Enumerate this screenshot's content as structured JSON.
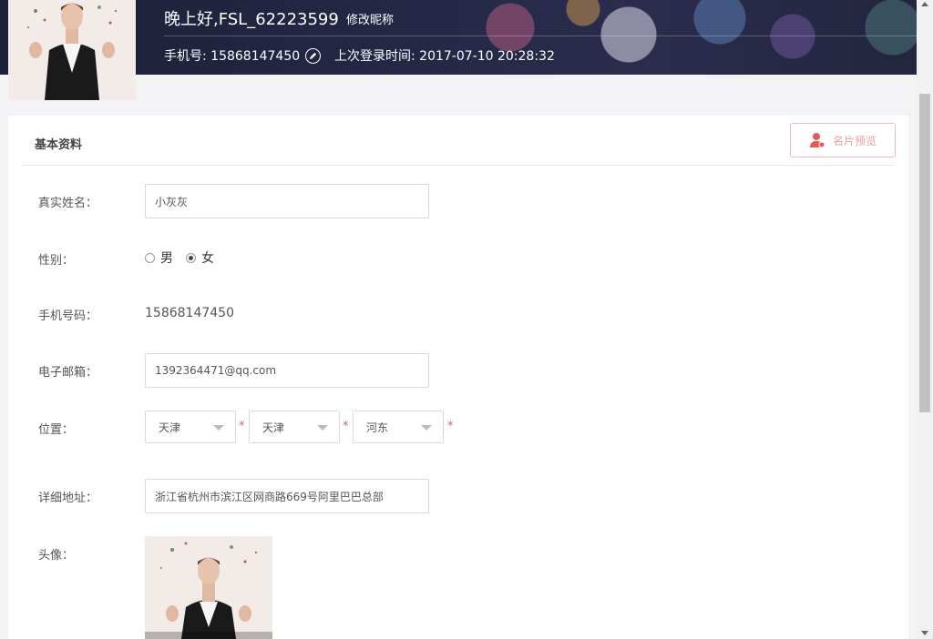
{
  "header": {
    "greeting": "晚上好,FSL_62223599",
    "edit_nickname": "修改昵称",
    "phone_text": "手机号: 15868147450",
    "last_login": "上次登录时间: 2017-07-10 20:28:32"
  },
  "panel": {
    "title": "基本资料",
    "preview_button": "名片预览"
  },
  "form": {
    "real_name_label": "真实姓名：",
    "real_name_value": "小灰灰",
    "gender_label": "性别：",
    "gender_options": [
      "男",
      "女"
    ],
    "gender_selected": "女",
    "mobile_label": "手机号码：",
    "mobile_value": "15868147450",
    "email_label": "电子邮箱：",
    "email_value": "1392364471@qq.com",
    "location_label": "位置：",
    "province": "天津",
    "city": "天津",
    "district": "河东",
    "required_mark": "*",
    "address_label": "详细地址：",
    "address_value": "浙江省杭州市滨江区网商路669号阿里巴巴总部",
    "avatar_label": "头像："
  },
  "colors": {
    "banner_bg": "#22263e",
    "required": "#e8585a",
    "preview_border": "#f2b8b8"
  }
}
